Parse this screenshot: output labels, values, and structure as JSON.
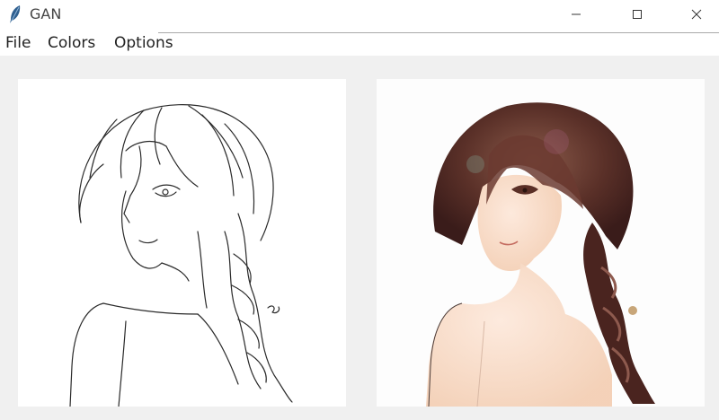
{
  "window": {
    "title": "GAN",
    "icon": "feather-icon",
    "controls": [
      "minimize-icon",
      "maximize-icon",
      "close-icon"
    ]
  },
  "menu": {
    "items": [
      {
        "label": "File"
      },
      {
        "label": "Colors"
      },
      {
        "label": "Options"
      }
    ]
  },
  "panels": {
    "input": {
      "kind": "sketch",
      "icon": "line-drawing"
    },
    "output": {
      "kind": "colorized",
      "icon": "painted-portrait"
    }
  }
}
